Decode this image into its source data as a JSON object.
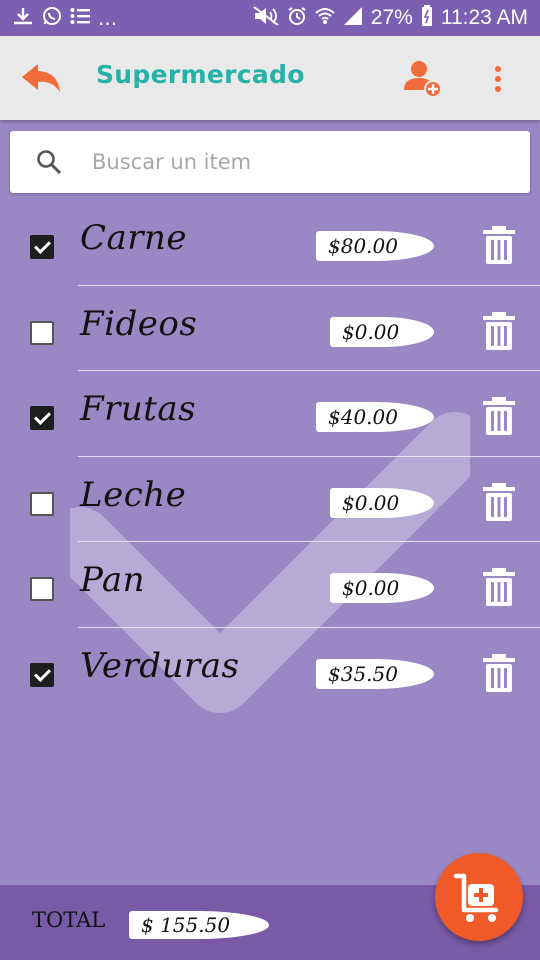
{
  "status_bar": {
    "left_icons": [
      "download-icon",
      "whatsapp-icon",
      "list-icon",
      "more-dots"
    ],
    "left_more": "...",
    "battery_percent": "27%",
    "time": "11:23 AM"
  },
  "toolbar": {
    "title": "Supermercado",
    "accent_color": "#f26b3a",
    "title_color": "#26b2a4"
  },
  "search": {
    "placeholder": "Buscar un item",
    "value": ""
  },
  "items": [
    {
      "name": "Carne",
      "price": "$80.00",
      "checked": true
    },
    {
      "name": "Fideos",
      "price": "$0.00",
      "checked": false
    },
    {
      "name": "Frutas",
      "price": "$40.00",
      "checked": true
    },
    {
      "name": "Leche",
      "price": "$0.00",
      "checked": false
    },
    {
      "name": "Pan",
      "price": "$0.00",
      "checked": false
    },
    {
      "name": "Verduras",
      "price": "$35.50",
      "checked": true
    }
  ],
  "footer": {
    "total_label": "TOTAL",
    "total_value": "$ 155.50"
  },
  "colors": {
    "background": "#9a88c4",
    "status_bar": "#7c5fb0",
    "bottom_bar": "#785aa6",
    "fab": "#f05a28"
  }
}
